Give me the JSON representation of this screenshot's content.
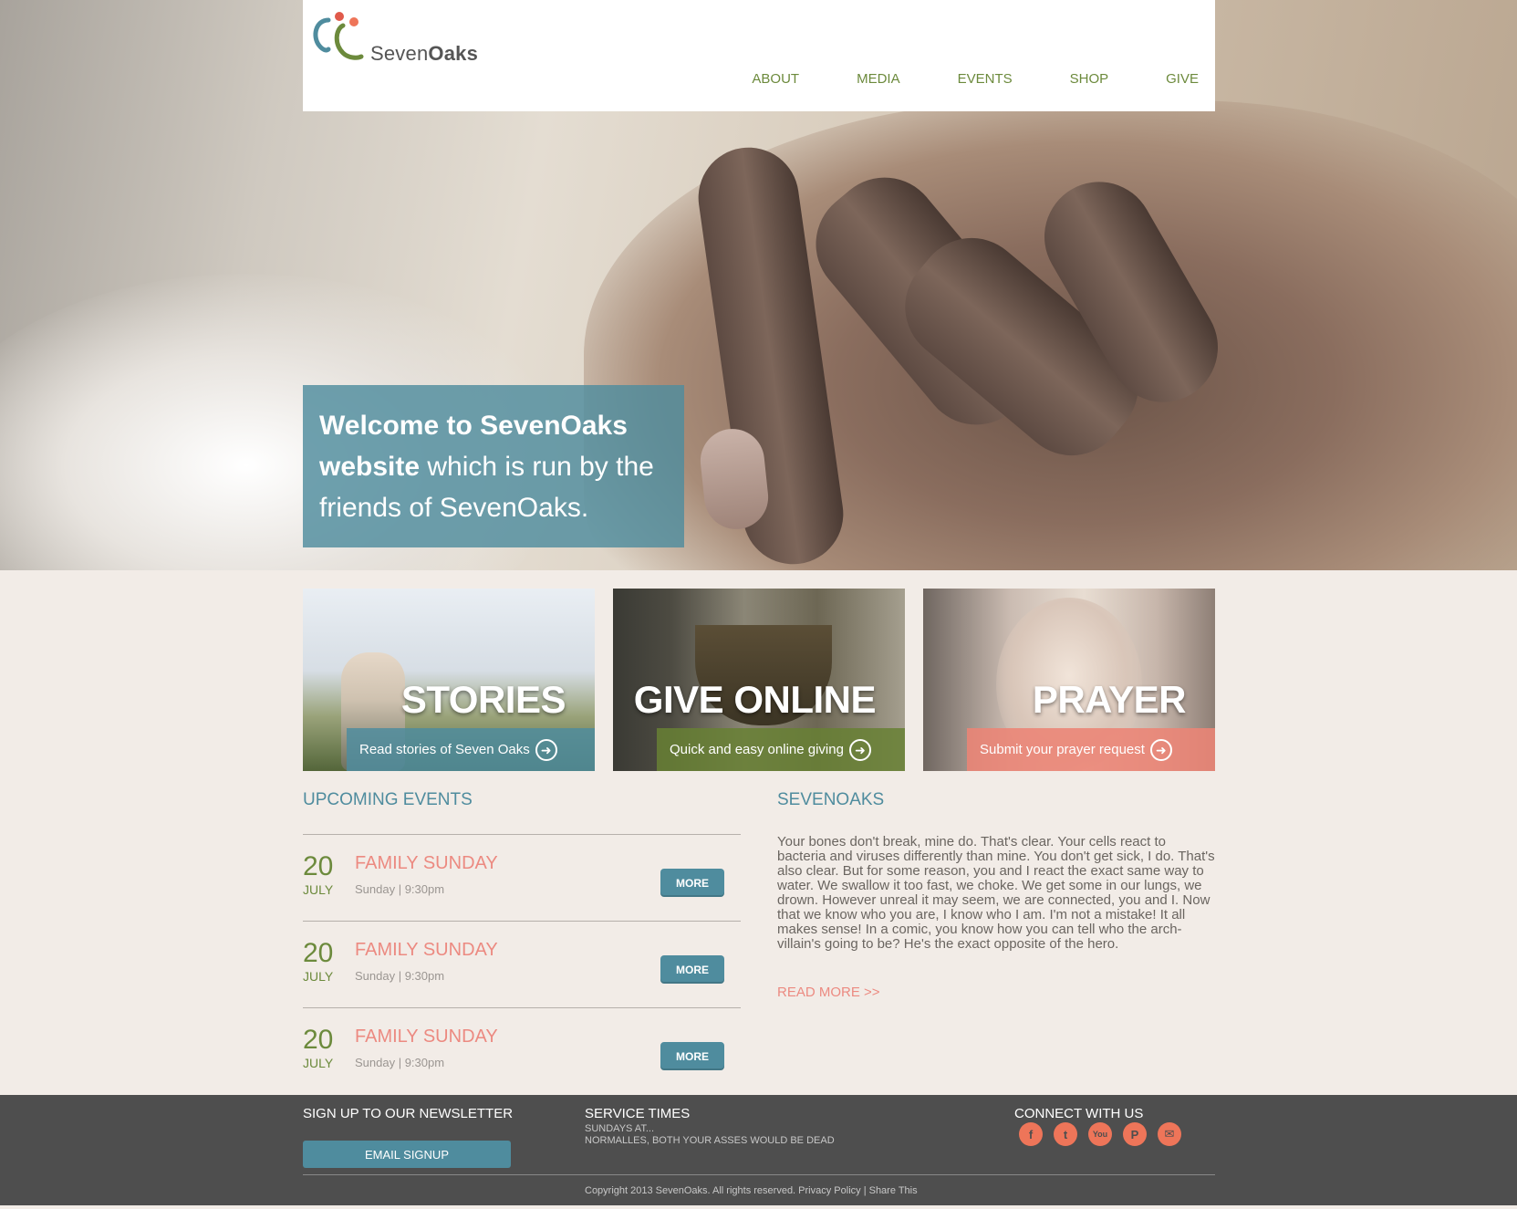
{
  "header": {
    "logo_prefix": "Seven",
    "logo_bold": "Oaks",
    "nav": [
      "ABOUT",
      "MEDIA",
      "EVENTS",
      "SHOP",
      "GIVE"
    ]
  },
  "hero": {
    "welcome_bold": "Welcome to SevenOaks website",
    "welcome_rest": " which is run by the friends of SevenOaks."
  },
  "cards": [
    {
      "title": "STORIES",
      "caption": "Read stories of Seven Oaks",
      "accent": "#4f8c9e"
    },
    {
      "title": "GIVE ONLINE",
      "caption": "Quick and easy online giving",
      "accent": "#678034"
    },
    {
      "title": "PRAYER",
      "caption": "Submit your prayer request",
      "accent": "#ec8475"
    }
  ],
  "events": {
    "title": "UPCOMING EVENTS",
    "items": [
      {
        "day": "20",
        "month": "JULY",
        "title": "FAMILY SUNDAY",
        "meta": "Sunday | 9:30pm",
        "button": "MORE"
      },
      {
        "day": "20",
        "month": "JULY",
        "title": "FAMILY SUNDAY",
        "meta": "Sunday | 9:30pm",
        "button": "MORE"
      },
      {
        "day": "20",
        "month": "JULY",
        "title": "FAMILY SUNDAY",
        "meta": "Sunday | 9:30pm",
        "button": "MORE"
      }
    ]
  },
  "about": {
    "title": "SEVENOAKS",
    "body": "Your bones don't break, mine do. That's clear. Your cells react to bacteria and viruses differently than mine. You don't get sick, I do. That's also clear. But for some reason, you and I react the exact same way to water. We swallow it too fast, we choke. We get some in our lungs, we drown. However unreal it may seem, we are connected, you and I. Now that we know who you are, I know who I am. I'm not a mistake! It all makes sense! In a comic, you know how you can tell who the arch-villain's going to be? He's the exact opposite of the hero.",
    "read_more": "READ MORE >>"
  },
  "footer": {
    "newsletter_title": "SIGN UP TO OUR NEWSLETTER",
    "signup_button": "EMAIL SIGNUP",
    "service_title": "SERVICE TIMES",
    "service_line1": "SUNDAYS AT...",
    "service_line2": "NORMALLES, BOTH YOUR ASSES WOULD BE DEAD",
    "connect_title": "CONNECT WITH US",
    "social_icons": [
      "facebook-icon",
      "twitter-icon",
      "youtube-icon",
      "paypal-icon",
      "email-icon"
    ],
    "social_glyphs": [
      "f",
      "t",
      "You",
      "P",
      "✉"
    ],
    "copyright": "Copyright 2013 SevenOaks. All rights reserved. Privacy Policy | Share This"
  },
  "colors": {
    "teal": "#4f8c9e",
    "green": "#6c8a3c",
    "coral": "#ec8a81",
    "footer_bg": "#4e4e4e",
    "page_bg": "#f2ece7"
  }
}
